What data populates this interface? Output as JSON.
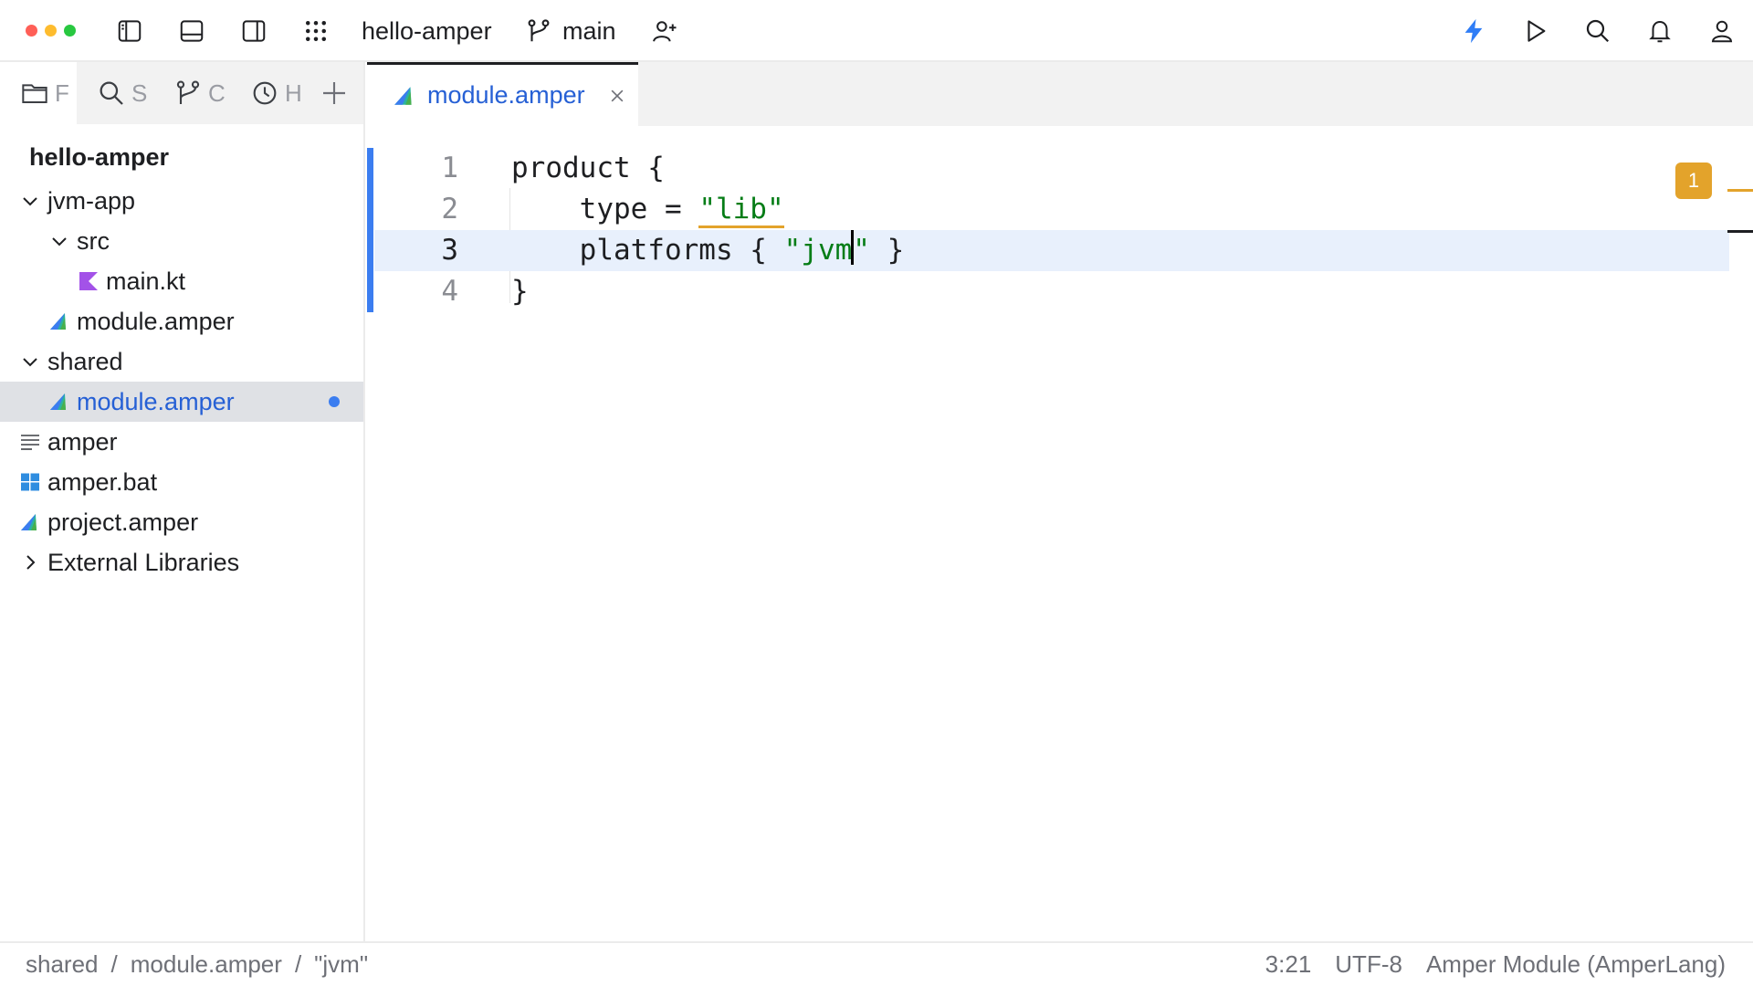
{
  "titlebar": {
    "project_name": "hello-amper",
    "branch": "main",
    "window_controls": {
      "close_color": "#ff5f57",
      "minimize_color": "#febc2e",
      "zoom_color": "#28c840"
    },
    "icons": [
      "toggle-left-panel-icon",
      "toggle-bottom-panel-icon",
      "toggle-right-panel-icon",
      "main-menu-grid-icon",
      "git-branch-icon",
      "add-collaborator-icon",
      "ai-assistant-bolt-icon",
      "run-icon",
      "search-everywhere-icon",
      "notifications-bell-icon",
      "account-icon"
    ]
  },
  "toolwindow_tabs": [
    {
      "label": "F",
      "icon": "folder-icon"
    },
    {
      "label": "S",
      "icon": "search-icon"
    },
    {
      "label": "C",
      "icon": "commit-icon"
    },
    {
      "label": "H",
      "icon": "history-clock-icon"
    }
  ],
  "tree": {
    "root": "hello-amper",
    "items": [
      {
        "label": "jvm-app",
        "arrow": "expanded",
        "depth": 0
      },
      {
        "label": "src",
        "arrow": "expanded",
        "depth": 1
      },
      {
        "label": "main.kt",
        "icon": "kotlin-file-icon",
        "depth": 2
      },
      {
        "label": "module.amper",
        "icon": "amper-file-icon",
        "depth": 1
      },
      {
        "label": "shared",
        "arrow": "expanded",
        "depth": 0
      },
      {
        "label": "module.amper",
        "icon": "amper-file-icon",
        "depth": 1,
        "selected": true,
        "modified": true
      },
      {
        "label": "amper",
        "icon": "text-file-icon",
        "depth": 0
      },
      {
        "label": "amper.bat",
        "icon": "windows-batch-icon",
        "depth": 0
      },
      {
        "label": "project.amper",
        "icon": "amper-file-icon",
        "depth": 0
      },
      {
        "label": "External Libraries",
        "arrow": "collapsed",
        "depth": 0
      }
    ]
  },
  "editor": {
    "tab_label": "module.amper",
    "lines": [
      {
        "num": "1",
        "pre": "product {",
        "str": "",
        "post": ""
      },
      {
        "num": "2",
        "pre": "    type = ",
        "str": "\"lib\"",
        "post": ""
      },
      {
        "num": "3",
        "pre": "    platforms { ",
        "str": "\"jvm",
        "str_after_caret": "\"",
        "post": " }"
      },
      {
        "num": "4",
        "pre": "}",
        "str": "",
        "post": ""
      }
    ],
    "problems_count": "1",
    "colors": {
      "string": "#067d17",
      "warning": "#e3a32b",
      "accent": "#3b7df0",
      "selected_text": "#2660d5"
    }
  },
  "statusbar": {
    "breadcrumbs": [
      "shared",
      "module.amper",
      "\"jvm\""
    ],
    "separator": "/",
    "position": "3:21",
    "encoding": "UTF-8",
    "file_type": "Amper Module (AmperLang)"
  }
}
